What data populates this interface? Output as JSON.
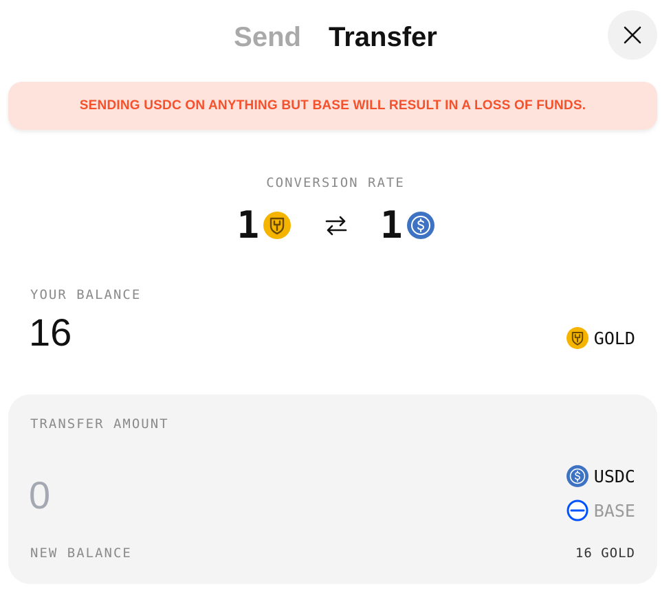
{
  "tabs": [
    {
      "label": "Send",
      "active": false
    },
    {
      "label": "Transfer",
      "active": true
    }
  ],
  "close_icon": "close-icon",
  "warning": {
    "text": "SENDING USDC ON ANYTHING BUT BASE WILL RESULT IN A LOSS OF FUNDS.",
    "color": "#f4512c",
    "background": "#fde3dc"
  },
  "conversion": {
    "label": "CONVERSION RATE",
    "from_amount": "1",
    "from_icon": "gold-coin-icon",
    "swap_icon": "swap-arrows-icon",
    "to_amount": "1",
    "to_icon": "usdc-coin-icon"
  },
  "balance": {
    "label": "YOUR BALANCE",
    "value": "16",
    "token": "GOLD",
    "token_icon": "gold-coin-icon"
  },
  "transfer": {
    "label": "TRANSFER AMOUNT",
    "amount_placeholder": "0",
    "token": "USDC",
    "token_icon": "usdc-coin-icon",
    "network": "BASE",
    "network_icon": "base-network-icon",
    "new_balance_label": "NEW BALANCE",
    "new_balance_value": "16 GOLD"
  },
  "colors": {
    "gold": "#f5b400",
    "usdc": "#3e73c4",
    "base": "#0052ff",
    "panel": "#f4f4f4"
  }
}
